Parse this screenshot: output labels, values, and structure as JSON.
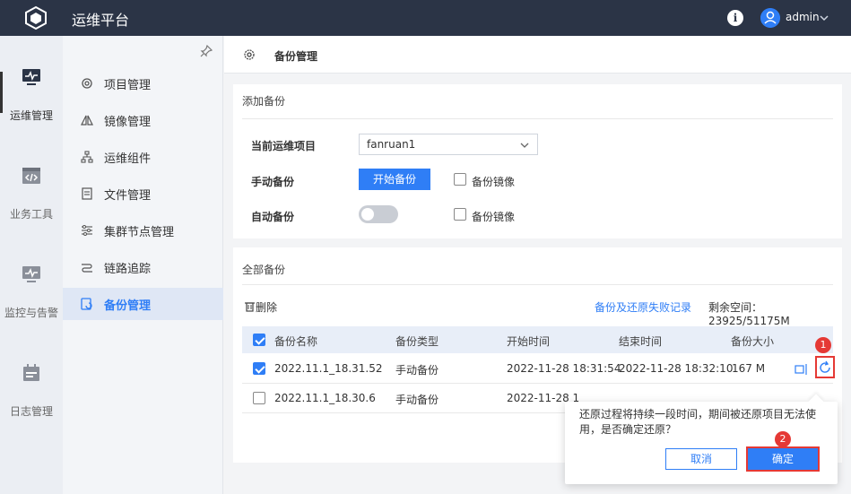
{
  "app": {
    "title": "运维平台",
    "username": "admin"
  },
  "rail": [
    {
      "label": "运维管理",
      "icon": "monitor-pulse-icon"
    },
    {
      "label": "业务工具",
      "icon": "code-window-icon"
    },
    {
      "label": "监控与告警",
      "icon": "monitor-alert-icon"
    },
    {
      "label": "日志管理",
      "icon": "calendar-log-icon"
    }
  ],
  "menu": [
    {
      "label": "项目管理",
      "icon": "gear-icon"
    },
    {
      "label": "镜像管理",
      "icon": "image-mirror-icon"
    },
    {
      "label": "运维组件",
      "icon": "hierarchy-icon"
    },
    {
      "label": "文件管理",
      "icon": "document-icon"
    },
    {
      "label": "集群节点管理",
      "icon": "sliders-icon"
    },
    {
      "label": "链路追踪",
      "icon": "trace-link-icon"
    },
    {
      "label": "备份管理",
      "icon": "backup-icon"
    }
  ],
  "header": {
    "title": "备份管理"
  },
  "add_backup": {
    "title": "添加备份",
    "project_label": "当前运维项目",
    "project_value": "fanruan1",
    "manual_label": "手动备份",
    "start_button": "开始备份",
    "mirror_label_1": "备份镜像",
    "auto_label": "自动备份",
    "mirror_label_2": "备份镜像",
    "auto_enabled": false
  },
  "all_backups": {
    "title": "全部备份",
    "delete_label": "删除",
    "fail_log_link": "备份及还原失败记录",
    "space_label": "剩余空间：23925/51175M",
    "columns": [
      "备份名称",
      "备份类型",
      "开始时间",
      "结束时间",
      "备份大小"
    ],
    "rows": [
      {
        "name": "2022.11.1_18.31.52",
        "type": "手动备份",
        "start": "2022-11-28 18:31:54",
        "end": "2022-11-28 18:32:10",
        "size": "167 M",
        "checked": true
      },
      {
        "name": "2022.11.1_18.30.6",
        "type": "手动备份",
        "start": "2022-11-28 1",
        "end": "",
        "size": "",
        "checked": false
      }
    ]
  },
  "popconfirm": {
    "message": "还原过程将持续一段时间，期间被还原项目无法使用，是否确定还原？",
    "cancel": "取消",
    "ok": "确定"
  },
  "annotations": {
    "badge1": "1",
    "badge2": "2"
  },
  "colors": {
    "topbar": "#2b3446",
    "accent": "#2f7ef6",
    "highlight": "#e53935"
  }
}
